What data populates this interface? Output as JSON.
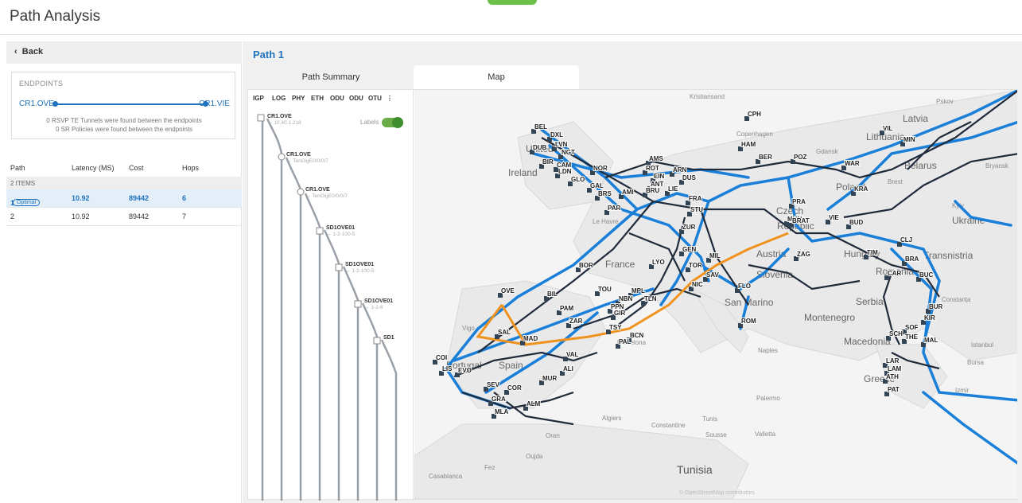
{
  "app": {
    "title": "Path Analysis"
  },
  "left": {
    "back_label": "Back",
    "endpoints": {
      "label": "ENDPOINTS",
      "source": "CR1.OVE",
      "destination": "CR1.VIE",
      "msg_rsvp": "0 RSVP TE Tunnels were found between the endpoints",
      "msg_sr": "0 SR Policies were found between the endpoints"
    },
    "table": {
      "headers": [
        "Path",
        "Latency (MS)",
        "Cost",
        "Hops"
      ],
      "count": "2 ITEMS",
      "rows": [
        {
          "path": "1",
          "badge": "Optimal",
          "latency": "10.92",
          "cost": "89442",
          "hops": "6"
        },
        {
          "path": "2",
          "badge": "",
          "latency": "10.92",
          "cost": "89442",
          "hops": "7"
        }
      ]
    }
  },
  "right": {
    "path_title": "Path 1",
    "tabs": [
      "Path Summary",
      "Map"
    ],
    "active_tab": "Map",
    "layers": [
      "IGP",
      "LOG",
      "PHY",
      "ETH",
      "ODU",
      "ODU",
      "OTU"
    ],
    "labels_toggle": {
      "label": "Labels",
      "on": true
    },
    "hops": [
      {
        "name": "CR1.OVE",
        "detail": "10.40.1.218"
      },
      {
        "name": "CR1.OVE",
        "detail": "TenGigE0/0/0/7"
      },
      {
        "name": "CR1.OVE",
        "detail": "TenGigE0/0/0/7"
      },
      {
        "name": "SD1OVE01",
        "detail": "1-2-100-5"
      },
      {
        "name": "SD1OVE01",
        "detail": "1-2-100-5"
      },
      {
        "name": "SD1OVE01",
        "detail": "1-2-6"
      },
      {
        "name": "SD1",
        "detail": ""
      }
    ],
    "map": {
      "places": [
        "Kristiansand",
        "Pskov",
        "Latvia",
        "Lithuania",
        "Belarus",
        "Bryansk",
        "Ireland",
        "Gdansk",
        "Poland",
        "Brest",
        "Kyiv",
        "Ukraine",
        "Le Havre",
        "France",
        "Czech",
        "Republic",
        "Austria",
        "Hungary",
        "Slovenia",
        "Transnistria",
        "Romania",
        "Constanța",
        "Serbia",
        "Montenegro",
        "Macedonia",
        "Istanbul",
        "Bursa",
        "Greece",
        "Izmir",
        "Naples",
        "San Marino",
        "Palermo",
        "Vigo",
        "Portugal",
        "Spain",
        "Barcelona",
        "Algiers",
        "Tunis",
        "Constantine",
        "Sousse",
        "Valletta",
        "Oran",
        "Oujda",
        "Fez",
        "Casablanca",
        "Tunisia",
        "Copenhagen",
        "United"
      ],
      "copyright": "© OpenStreetMap contributors",
      "colors": {
        "blue_link": "#1a7fd8",
        "black_link": "#1f2a3a",
        "path": "#f0921e",
        "node": "#334455"
      },
      "node_labels": [
        "CPH",
        "BEL",
        "DUB",
        "DXL",
        "LVN",
        "NGT",
        "BIR",
        "LDN",
        "CAM",
        "NOR",
        "GLO",
        "GAL",
        "BRS",
        "AMS",
        "ROT",
        "ARN",
        "EIN",
        "ANT",
        "BRU",
        "DUS",
        "AMI",
        "LIE",
        "PAR",
        "FRA",
        "STU",
        "HAM",
        "BER",
        "POZ",
        "WAR",
        "VIL",
        "MIN",
        "PRA",
        "MUN",
        "KRA",
        "VIE",
        "BRAT",
        "BUD",
        "ZUR",
        "GEN",
        "LYO",
        "TOR",
        "MIL",
        "SAV",
        "NIC",
        "FLO",
        "ROM",
        "ZAG",
        "TIM",
        "CLJ",
        "BRA",
        "CAR",
        "BUC",
        "SOF",
        "BUR",
        "KIR",
        "MAL",
        "THE",
        "SCH",
        "LAR",
        "LAM",
        "ATH",
        "PAT",
        "OVE",
        "BIL",
        "PAM",
        "BOR",
        "TOU",
        "MPL",
        "NBN",
        "PPN",
        "TLN",
        "GIR",
        "ZAR",
        "SAL",
        "MAD",
        "VAL",
        "COI",
        "LIS",
        "EVO",
        "SEV",
        "COR",
        "GRA",
        "MLA",
        "ALM",
        "MUR",
        "ALI",
        "TSY",
        "BCN",
        "PAL"
      ]
    }
  }
}
